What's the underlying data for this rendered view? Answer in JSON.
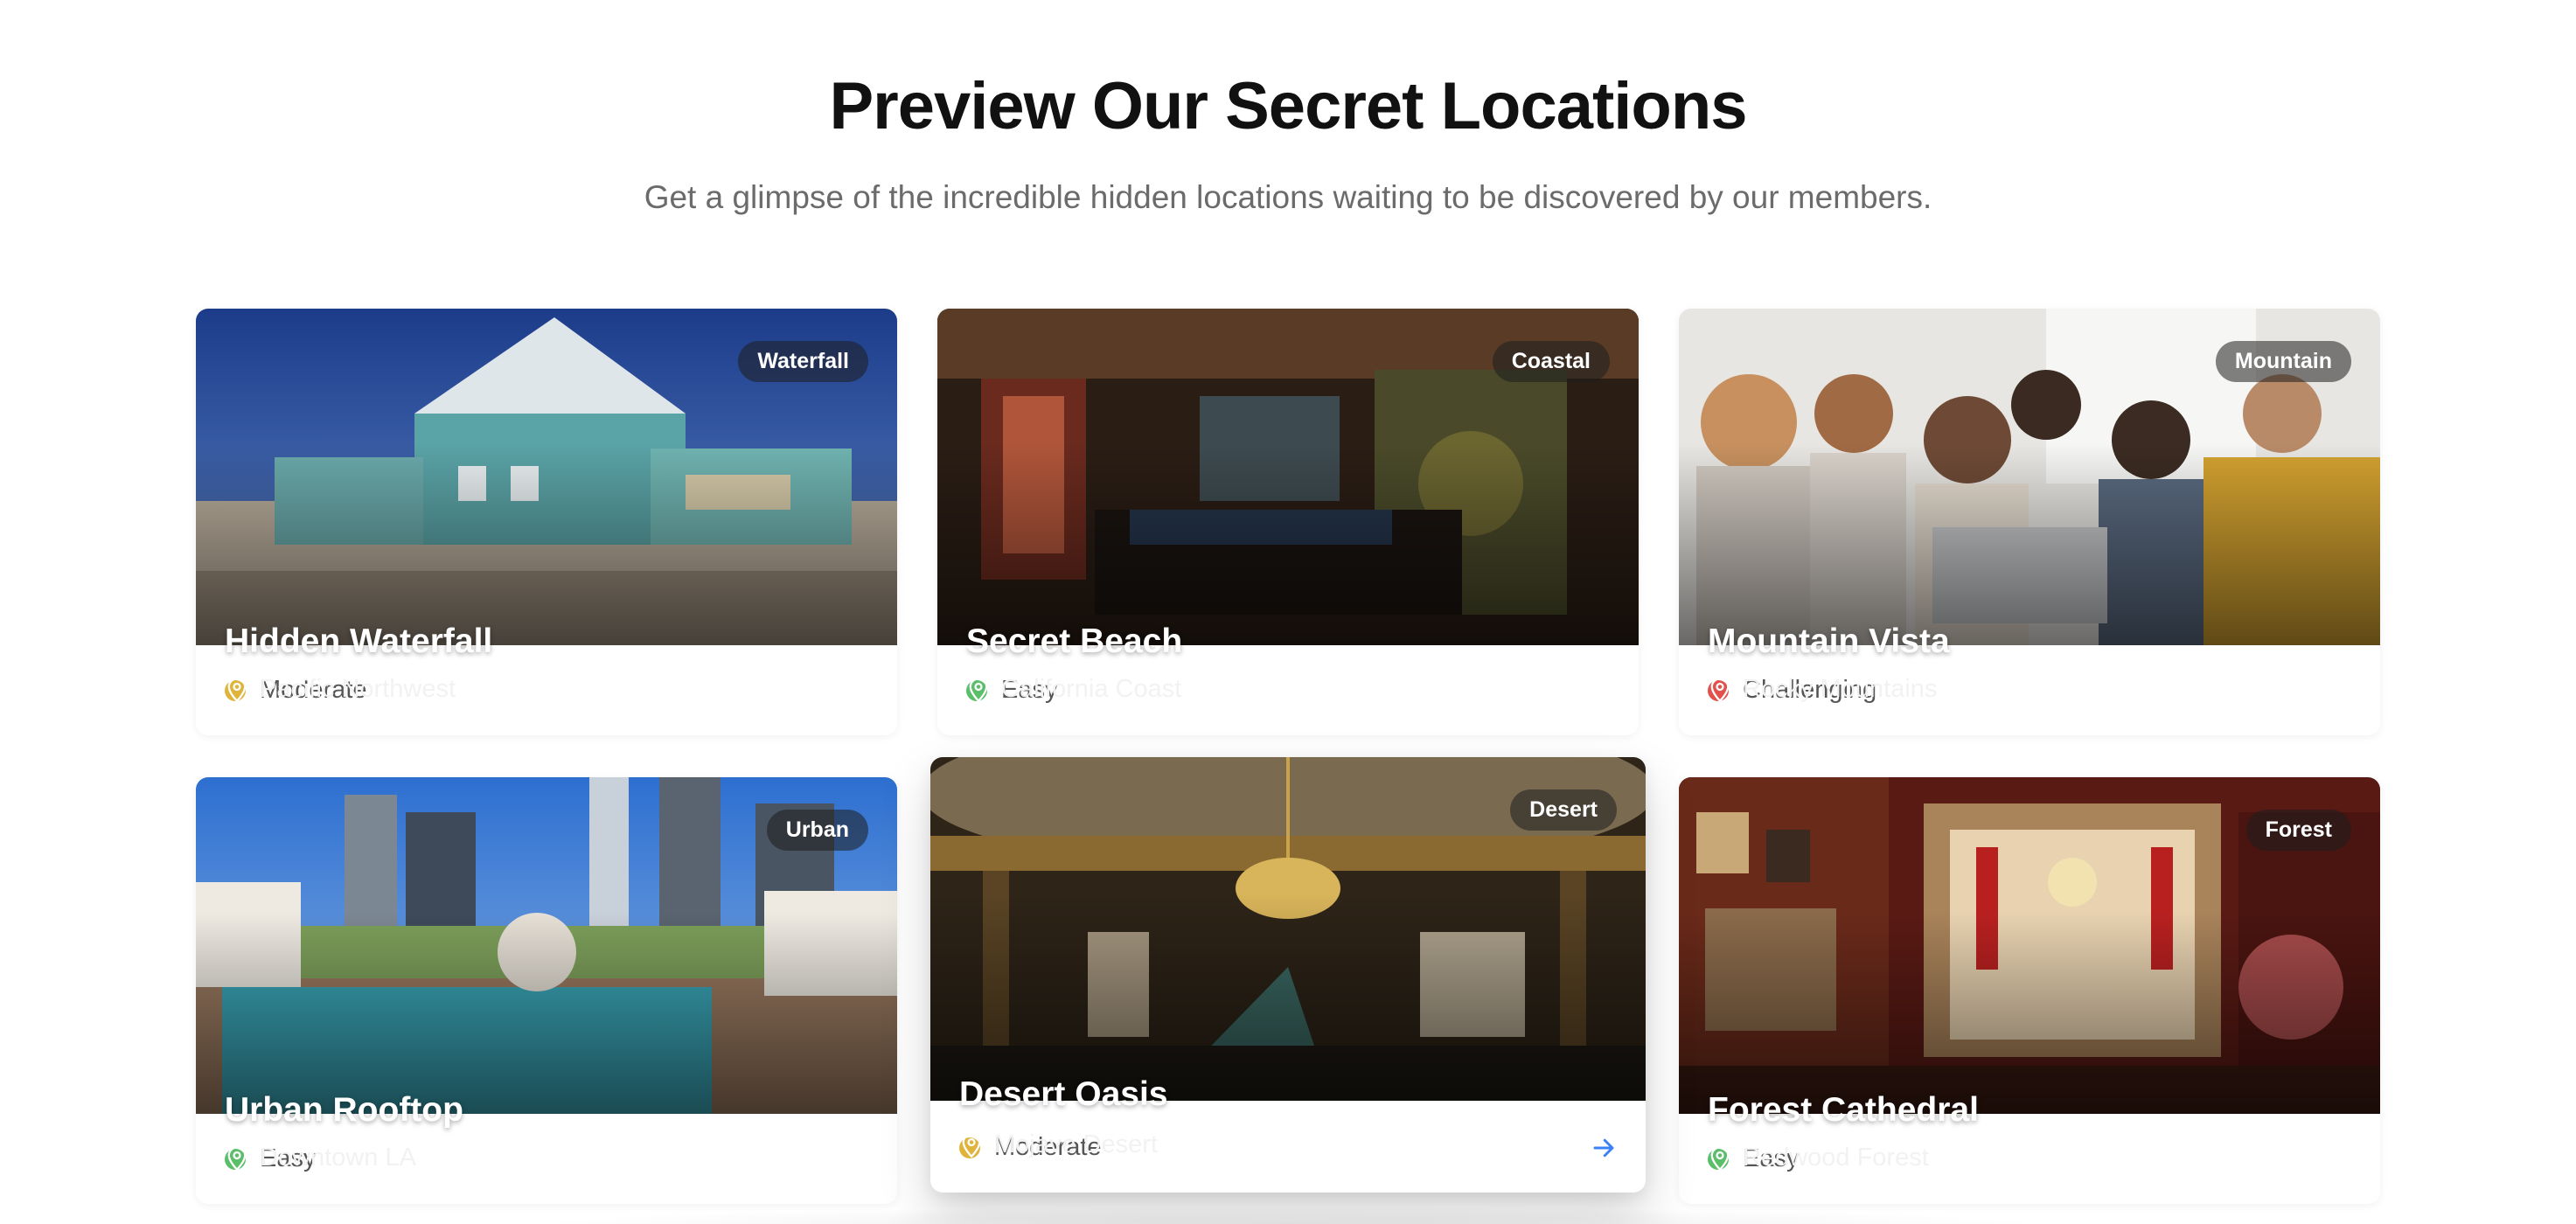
{
  "section": {
    "title": "Preview Our Secret Locations",
    "subtitle": "Get a glimpse of the incredible hidden locations waiting to be discovered by our members."
  },
  "colors": {
    "moderate": "#e0b43a",
    "easy": "#5bbf6a",
    "challenging": "#e2514b",
    "accent": "#3b82f6"
  },
  "cards": [
    {
      "category": "Waterfall",
      "name": "Hidden Waterfall",
      "location": "Pacific Northwest",
      "difficulty": "Moderate",
      "image": "teal-house-desert"
    },
    {
      "category": "Coastal",
      "name": "Secret Beach",
      "location": "California Coast",
      "difficulty": "Easy",
      "image": "speakeasy-bar-interior"
    },
    {
      "category": "Mountain",
      "name": "Mountain Vista",
      "location": "Rocky Mountains",
      "difficulty": "Challenging",
      "image": "people-around-laptop"
    },
    {
      "category": "Urban",
      "name": "Urban Rooftop",
      "location": "Downtown LA",
      "difficulty": "Easy",
      "image": "rooftop-pool-skyline"
    },
    {
      "category": "Desert",
      "name": "Desert Oasis",
      "location": "Mojave Desert",
      "difficulty": "Moderate",
      "image": "ornate-ballroom-chandelier"
    },
    {
      "category": "Forest",
      "name": "Forest Cathedral",
      "location": "Redwood Forest",
      "difficulty": "Easy",
      "image": "victorian-parlor-red"
    }
  ],
  "icons": {
    "location": "map-pin-icon",
    "arrow": "arrow-right-icon"
  }
}
